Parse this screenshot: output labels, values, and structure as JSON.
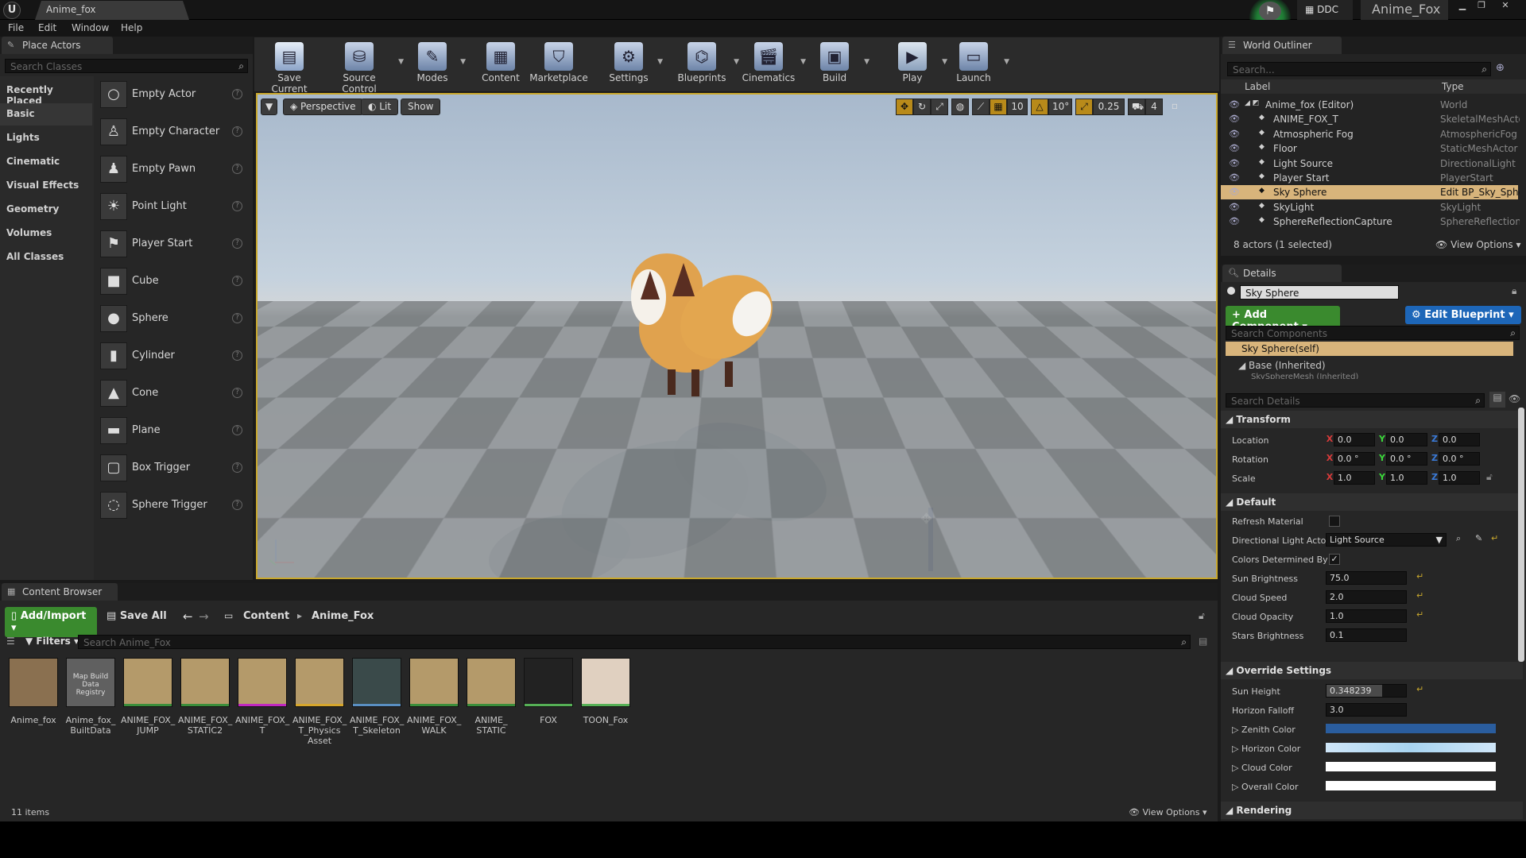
{
  "window": {
    "tab_title": "Anime_fox",
    "ddc": "DDC",
    "project": "Anime_Fox",
    "menu": [
      "File",
      "Edit",
      "Window",
      "Help"
    ]
  },
  "place_actors": {
    "tab": "Place Actors",
    "search_placeholder": "Search Classes",
    "categories": [
      "Recently Placed",
      "Basic",
      "Lights",
      "Cinematic",
      "Visual Effects",
      "Geometry",
      "Volumes",
      "All Classes"
    ],
    "selected_category": "Basic",
    "actors": [
      "Empty Actor",
      "Empty Character",
      "Empty Pawn",
      "Point Light",
      "Player Start",
      "Cube",
      "Sphere",
      "Cylinder",
      "Cone",
      "Plane",
      "Box Trigger",
      "Sphere Trigger"
    ]
  },
  "toolbar": {
    "buttons": [
      "Save Current",
      "Source Control",
      "Modes",
      "Content",
      "Marketplace",
      "Settings",
      "Blueprints",
      "Cinematics",
      "Build",
      "Play",
      "Launch"
    ]
  },
  "viewport": {
    "perspective": "Perspective",
    "lit": "Lit",
    "show": "Show",
    "grid_snap": "10",
    "rot_snap": "10°",
    "scale_snap": "0.25",
    "cam_speed": "4"
  },
  "outliner": {
    "tab": "World Outliner",
    "search_placeholder": "Search...",
    "col_label": "Label",
    "col_type": "Type",
    "rows": [
      {
        "label": "Anime_fox (Editor)",
        "type": "World"
      },
      {
        "label": "ANIME_FOX_T",
        "type": "SkeletalMeshActor"
      },
      {
        "label": "Atmospheric Fog",
        "type": "AtmosphericFog"
      },
      {
        "label": "Floor",
        "type": "StaticMeshActor"
      },
      {
        "label": "Light Source",
        "type": "DirectionalLight"
      },
      {
        "label": "Player Start",
        "type": "PlayerStart"
      },
      {
        "label": "Sky Sphere",
        "type": "Edit BP_Sky_Sphere"
      },
      {
        "label": "SkyLight",
        "type": "SkyLight"
      },
      {
        "label": "SphereReflectionCapture",
        "type": "SphereReflectionC"
      }
    ],
    "status": "8 actors (1 selected)",
    "view_options": "View Options"
  },
  "details": {
    "tab": "Details",
    "name": "Sky Sphere",
    "add_component": "Add Component",
    "edit_blueprint": "Edit Blueprint",
    "search_components": "Search Components",
    "self": "Sky Sphere(self)",
    "base": "Base (Inherited)",
    "mesh": "SkySphereMesh (Inherited)",
    "search_details": "Search Details",
    "transform": {
      "title": "Transform",
      "location_label": "Location",
      "rotation_label": "Rotation",
      "scale_label": "Scale",
      "location": [
        "0.0",
        "0.0",
        "0.0"
      ],
      "rotation": [
        "0.0 °",
        "0.0 °",
        "0.0 °"
      ],
      "scale": [
        "1.0",
        "1.0",
        "1.0"
      ]
    },
    "default": {
      "title": "Default",
      "refresh": "Refresh Material",
      "dir_light": "Directional Light Actor",
      "dir_light_value": "Light Source",
      "colors_det": "Colors Determined By",
      "sun_brightness": "Sun Brightness",
      "sun_brightness_v": "75.0",
      "cloud_speed": "Cloud Speed",
      "cloud_speed_v": "2.0",
      "cloud_opacity": "Cloud Opacity",
      "cloud_opacity_v": "1.0",
      "stars": "Stars Brightness",
      "stars_v": "0.1"
    },
    "override": {
      "title": "Override Settings",
      "sun_height": "Sun Height",
      "sun_height_v": "0.348239",
      "horizon_falloff": "Horizon Falloff",
      "horizon_falloff_v": "3.0",
      "zenith": "Zenith Color",
      "horizon": "Horizon Color",
      "cloud": "Cloud Color",
      "overall": "Overall Color"
    },
    "rendering": "Rendering",
    "colors": {
      "zenith": "#2a5d9e",
      "horizon": "#a8d4f0",
      "cloud": "#ffffff",
      "overall": "#ffffff"
    }
  },
  "content": {
    "tab": "Content Browser",
    "add_import": "Add/Import",
    "save_all": "Save All",
    "path": [
      "Content",
      "Anime_Fox"
    ],
    "filters": "Filters",
    "search_placeholder": "Search Anime_Fox",
    "count": "11 items",
    "view_options": "View Options",
    "assets": [
      {
        "name": "Anime_fox",
        "bar": ""
      },
      {
        "name": "Anime_fox_ BuiltData",
        "bar": "",
        "thumb_text": "Map Build Data Registry"
      },
      {
        "name": "ANIME_FOX_ JUMP",
        "bar": "#3b8e3b"
      },
      {
        "name": "ANIME_FOX_ STATIC2",
        "bar": "#3b8e3b"
      },
      {
        "name": "ANIME_FOX_ T",
        "bar": "#c027c0"
      },
      {
        "name": "ANIME_FOX_ T_Physics Asset",
        "bar": "#d6a62c"
      },
      {
        "name": "ANIME_FOX_ T_Skeleton",
        "bar": "#5a8fc2"
      },
      {
        "name": "ANIME_FOX_ WALK",
        "bar": "#3b8e3b"
      },
      {
        "name": "ANIME_ STATIC",
        "bar": "#3b8e3b"
      },
      {
        "name": "FOX",
        "bar": "#56b056"
      },
      {
        "name": "TOON_Fox",
        "bar": "#56b056"
      }
    ]
  }
}
